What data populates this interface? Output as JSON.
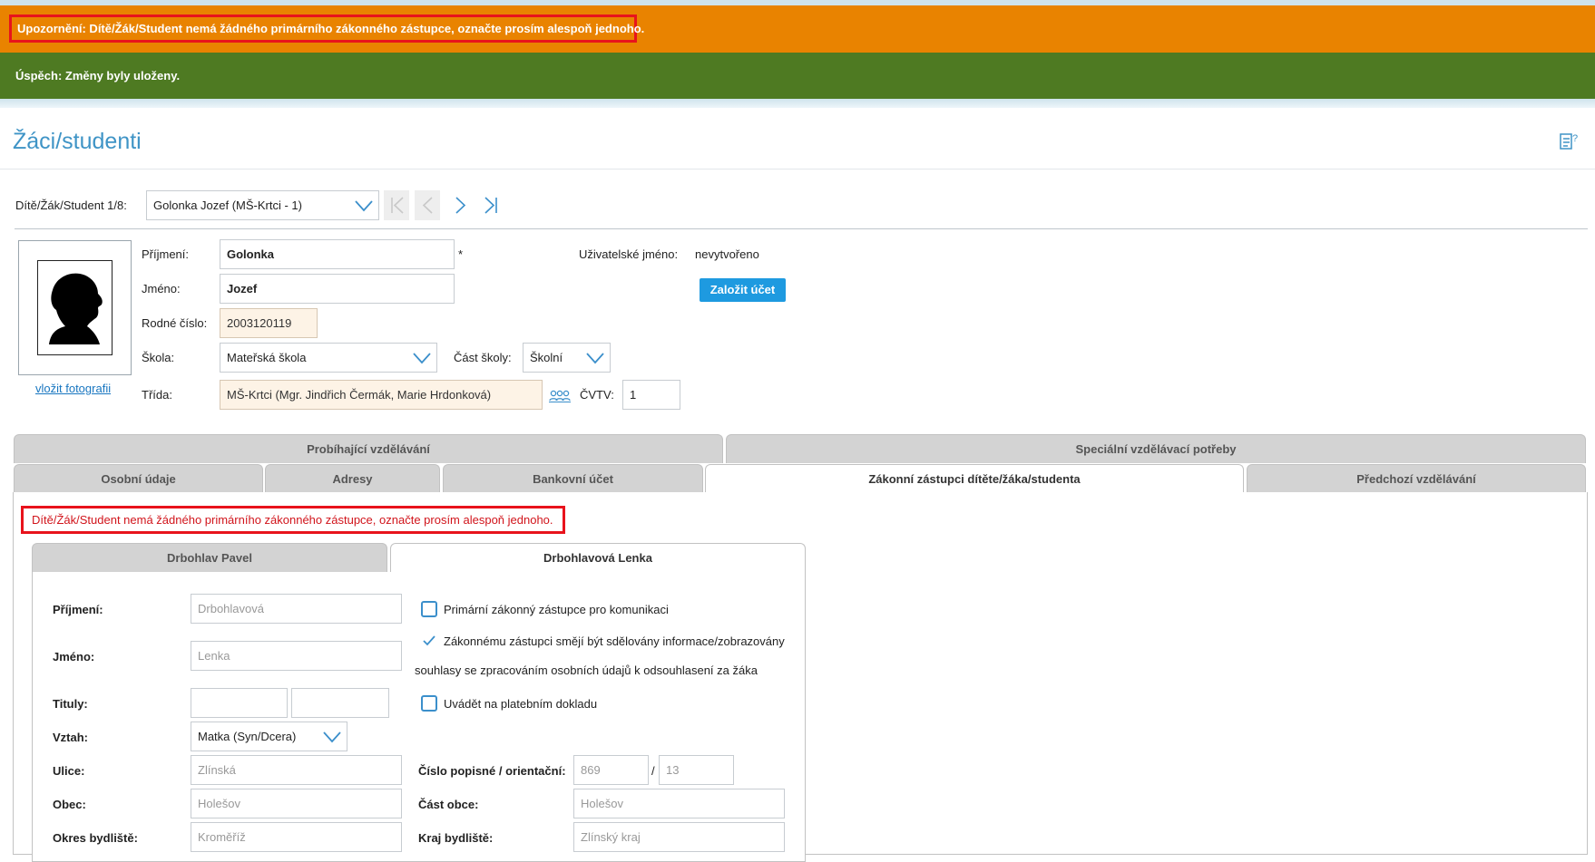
{
  "alerts": {
    "warning": "Upozornění:  Dítě/Žák/Student nemá žádného primárního zákonného zástupce, označte prosím alespoň jednoho.",
    "success": "Úspěch:  Změny byly uloženy."
  },
  "page": {
    "title": "Žáci/studenti"
  },
  "student_nav": {
    "label": "Dítě/Žák/Student 1/8:",
    "selected": "Golonka Jozef (MŠ-Krtci - 1)"
  },
  "student": {
    "surname_label": "Příjmení:",
    "surname": "Golonka",
    "required_mark": "*",
    "name_label": "Jméno:",
    "name": "Jozef",
    "birth_number_label": "Rodné číslo:",
    "birth_number": "2003120119",
    "school_label": "Škola:",
    "school": "Mateřská škola",
    "school_part_label": "Část školy:",
    "school_part": "Školní",
    "class_label": "Třída:",
    "class": "MŠ-Krtci (Mgr. Jindřich Čermák, Marie Hrdonková)",
    "cvtv_label": "ČVTV:",
    "cvtv": "1",
    "username_label": "Uživatelské jméno:",
    "username": "nevytvořeno",
    "create_account": "Založit účet",
    "insert_photo": "vložit fotografii"
  },
  "tabs_row1": [
    "Probíhající vzdělávání",
    "Speciální vzdělávací potřeby"
  ],
  "tabs_row2": [
    "Osobní údaje",
    "Adresy",
    "Bankovní účet",
    "Zákonní zástupci dítěte/žáka/studenta",
    "Předchozí vzdělávání"
  ],
  "guardian_error": "Dítě/Žák/Student nemá žádného primárního zákonného zástupce, označte prosím alespoň jednoho.",
  "guardian_tabs": [
    "Drbohlav Pavel",
    "Drbohlavová Lenka"
  ],
  "guardian": {
    "surname_label": "Příjmení:",
    "surname": "Drbohlavová",
    "name_label": "Jméno:",
    "name": "Lenka",
    "titles_label": "Tituly:",
    "relation_label": "Vztah:",
    "relation": "Matka (Syn/Dcera)",
    "street_label": "Ulice:",
    "street": "Zlínská",
    "number_label": "Číslo popisné / orientační:",
    "number_desc": "869",
    "number_sep": "/",
    "number_orient": "13",
    "city_label": "Obec:",
    "city": "Holešov",
    "city_part_label": "Část obce:",
    "city_part": "Holešov",
    "district_label": "Okres bydliště:",
    "district": "Kroměříž",
    "region_label": "Kraj bydliště:",
    "region": "Zlínský kraj",
    "primary_cb": "Primární zákonný zástupce pro komunikaci",
    "info_cb_line1": "Zákonnému zástupci smějí být sdělovány informace/zobrazovány",
    "info_cb_line2": "souhlasy se zpracováním osobních údajů k odsouhlasení za žáka",
    "payment_cb": "Uvádět na platebním dokladu"
  },
  "icons": {
    "help": "help-doc-icon",
    "chevron": "chevron-down-icon",
    "class_picker": "class-picker-icon",
    "silhouette": "photo-placeholder-icon"
  },
  "colors": {
    "warning": "#e98300",
    "success": "#4e7a22",
    "error": "#e8131c",
    "accent": "#3f94c6",
    "button": "#1e9ae0"
  }
}
